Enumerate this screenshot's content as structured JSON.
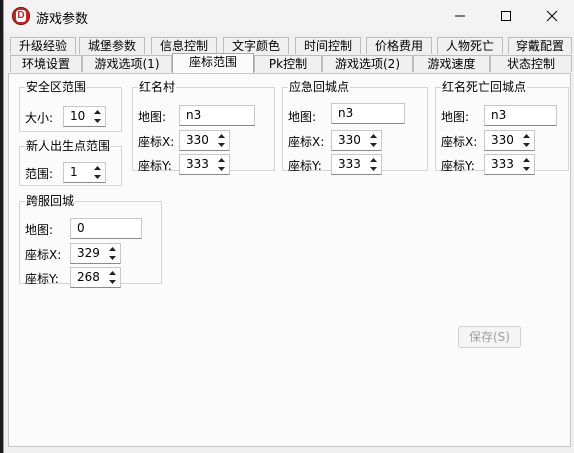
{
  "window": {
    "title": "游戏参数"
  },
  "tabs_row1": [
    "升级经验",
    "城堡参数",
    "信息控制",
    "文字颜色",
    "时间控制",
    "价格费用",
    "人物死亡",
    "穿戴配置"
  ],
  "tabs_row2": [
    "环境设置",
    "游戏选项(1)",
    "座标范围",
    "Pk控制",
    "游戏选项(2)",
    "游戏速度",
    "状态控制"
  ],
  "active_tab": "座标范围",
  "safe_zone": {
    "legend": "安全区范围",
    "size_label": "大小:",
    "size_value": "10"
  },
  "newbie_zone": {
    "legend": "新人出生点范围",
    "range_label": "范围:",
    "range_value": "1"
  },
  "red_village": {
    "legend": "红名村",
    "map_label": "地图:",
    "map_value": "n3",
    "x_label": "座标X:",
    "x_value": "330",
    "y_label": "座标Y:",
    "y_value": "333"
  },
  "emergency_return": {
    "legend": "应急回城点",
    "map_label": "地图:",
    "map_value": "n3",
    "x_label": "座标X:",
    "x_value": "330",
    "y_label": "座标Y:",
    "y_value": "333"
  },
  "red_death_return": {
    "legend": "红名死亡回城点",
    "map_label": "地图:",
    "map_value": "n3",
    "x_label": "座标X:",
    "x_value": "330",
    "y_label": "座标Y:",
    "y_value": "333"
  },
  "cross_server_return": {
    "legend": "跨服回城",
    "map_label": "地图:",
    "map_value": "0",
    "x_label": "座标X:",
    "x_value": "329",
    "y_label": "座标Y:",
    "y_value": "268"
  },
  "save_button": {
    "label": "保存(S)"
  }
}
